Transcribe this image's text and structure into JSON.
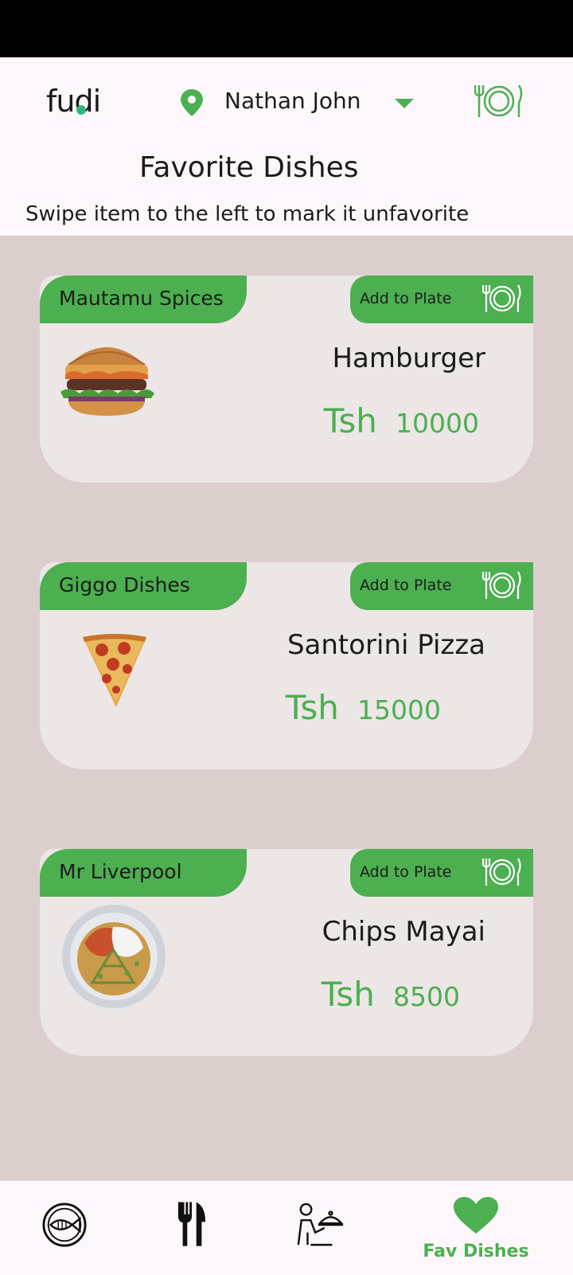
{
  "header": {
    "logo_text": "fudi",
    "user_name": "Nathan John",
    "page_title": "Favorite Dishes",
    "hint": "Swipe item to the left to mark it unfavorite"
  },
  "colors": {
    "accent": "#4caf50",
    "card_bg": "#ece6e6",
    "page_bg": "#dbcfcd"
  },
  "icons": {
    "location": "location-pin-icon",
    "dropdown": "triangle-down-icon",
    "plate": "plate-cutlery-icon"
  },
  "favorites": [
    {
      "restaurant": "Mautamu Spices",
      "action_label": "Add to Plate",
      "dish": "Hamburger",
      "currency": "Tsh",
      "price": "10000",
      "image": "hamburger"
    },
    {
      "restaurant": "Giggo Dishes",
      "action_label": "Add to Plate",
      "dish": "Santorini Pizza",
      "currency": "Tsh",
      "price": "15000",
      "image": "pizza-slice"
    },
    {
      "restaurant": "Mr Liverpool",
      "action_label": "Add to Plate",
      "dish": "Chips Mayai",
      "currency": "Tsh",
      "price": "8500",
      "image": "chips-mayai-plate"
    }
  ],
  "bottom_nav": {
    "items": [
      {
        "icon": "fish-plate-icon",
        "label": ""
      },
      {
        "icon": "fork-knife-icon",
        "label": ""
      },
      {
        "icon": "waiter-icon",
        "label": ""
      },
      {
        "icon": "heart-icon",
        "label": "Fav Dishes",
        "active": true
      }
    ]
  }
}
